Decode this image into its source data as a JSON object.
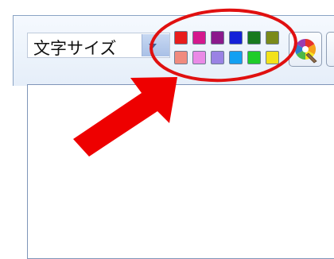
{
  "font_size_select": {
    "label": "文字サイズ"
  },
  "palette": {
    "row1": [
      "#e81c1c",
      "#d4188d",
      "#8b1a8c",
      "#1421d8",
      "#187a1f",
      "#7a8a1a"
    ],
    "row2": [
      "#f08a7e",
      "#ea8ae6",
      "#9a82e4",
      "#12a0f2",
      "#1ecc2a",
      "#f2e21a"
    ]
  },
  "annotation": {
    "ellipse_color": "#e01010",
    "arrow_color": "#ee0000"
  },
  "icons": {
    "color_picker": "color-wheel-icon"
  }
}
